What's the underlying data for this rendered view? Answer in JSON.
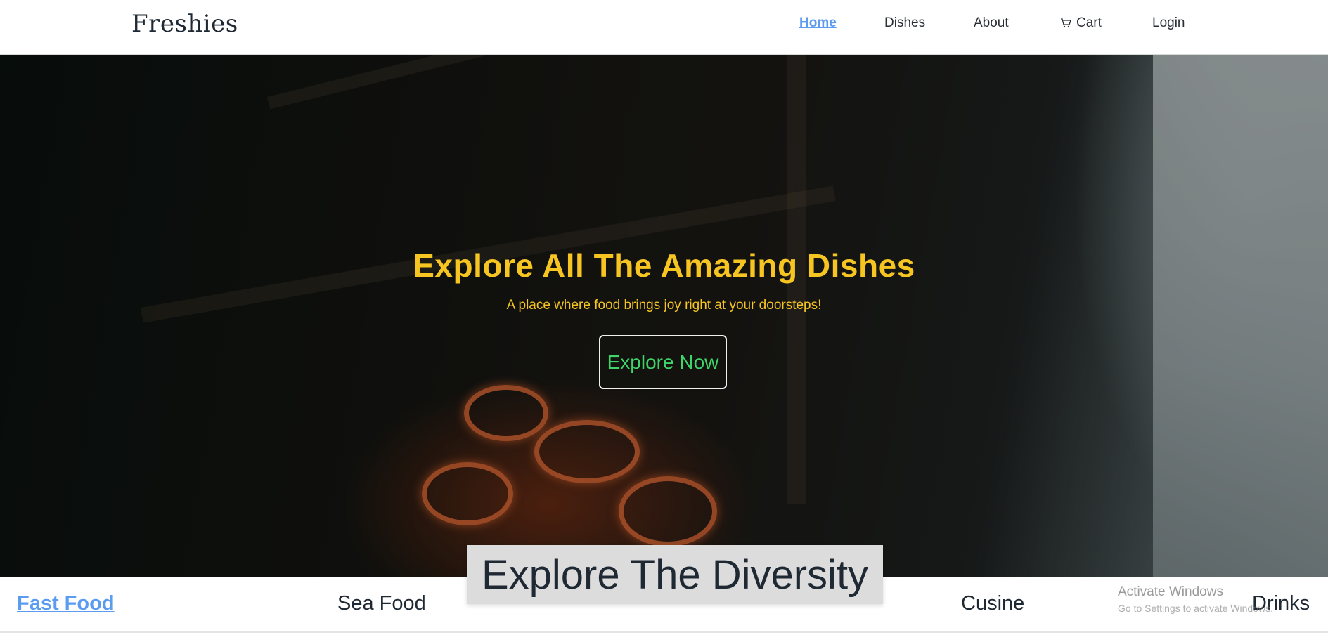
{
  "navbar": {
    "brand": "Freshies",
    "links": {
      "home": "Home",
      "dishes": "Dishes",
      "about": "About",
      "cart": "Cart",
      "login": "Login"
    },
    "active_link": "Home",
    "cart_icon": "cart-icon"
  },
  "hero": {
    "title": "Explore All The Amazing Dishes",
    "subtitle": "A place where food brings joy right at your doorsteps!",
    "cta_label": "Explore Now"
  },
  "diversity": {
    "heading": "Explore The Diversity"
  },
  "categories": {
    "fast_food": "Fast Food",
    "sea_food": "Sea Food",
    "cusine": "Cusine",
    "drinks": "Drinks",
    "active": "Fast Food"
  },
  "watermark": {
    "title": "Activate Windows",
    "subtitle": "Go to Settings to activate Windows."
  },
  "colors": {
    "accent_link": "#5b9bf0",
    "hero_text": "#f6c522",
    "cta_text": "#3fd46a",
    "dark_text": "#1f2933"
  }
}
